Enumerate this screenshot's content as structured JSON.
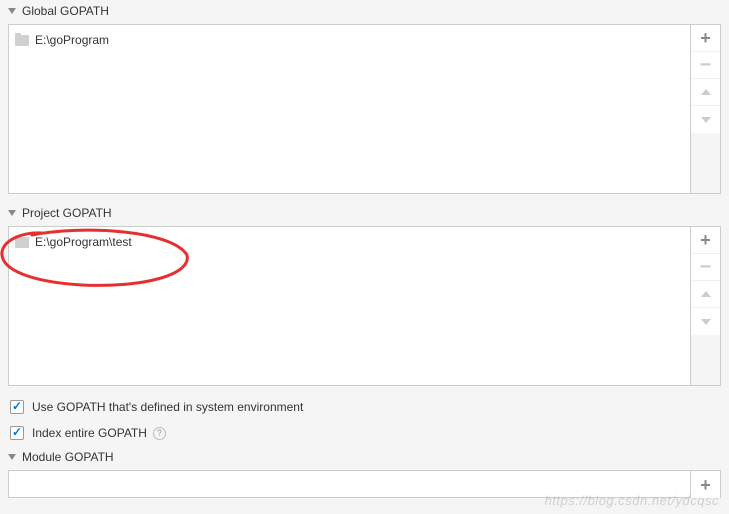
{
  "sections": {
    "global": {
      "title": "Global GOPATH",
      "items": [
        "E:\\goProgram"
      ]
    },
    "project": {
      "title": "Project GOPATH",
      "items": [
        "E:\\goProgram\\test"
      ]
    },
    "module": {
      "title": "Module GOPATH"
    }
  },
  "checkboxes": {
    "useSystemGopath": {
      "label": "Use GOPATH that's defined in system environment",
      "checked": true
    },
    "indexEntire": {
      "label": "Index entire GOPATH",
      "checked": true
    }
  },
  "watermark": "https://blog.csdn.net/ydcqsc"
}
